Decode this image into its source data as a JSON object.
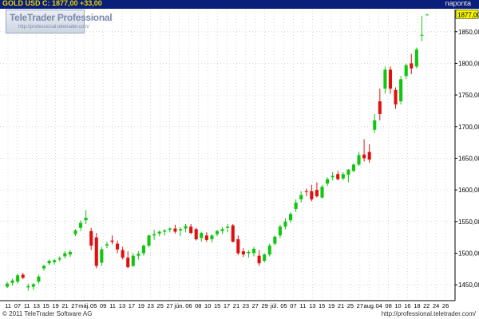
{
  "header": {
    "symbol": "GOLD USD C: 1877,00 +33,00",
    "interval": "naponta"
  },
  "logo": {
    "title": "TeleTrader Professional",
    "subtitle": "http://professional.teletrader.com/"
  },
  "footer": {
    "copyright": "© 2011 TeleTrader Software AG",
    "link": "http://professional.teletrader.com/"
  },
  "colors": {
    "up": "#11c611",
    "down": "#e01010",
    "background": "#ffffff",
    "grid": "#bdbdbd",
    "header_bg": "#0a1f7a",
    "symbol_text": "#e8d400",
    "last_price_box": "#f5f500"
  },
  "chart_data": {
    "type": "candlestick",
    "y_axis_side": "right",
    "ylim": [
      1425,
      1885
    ],
    "ytick_values": [
      1450,
      1500,
      1550,
      1600,
      1650,
      1700,
      1750,
      1800,
      1850
    ],
    "ytick_labels": [
      "1450,00",
      "1500,00",
      "1550,00",
      "1600,00",
      "1650,00",
      "1700,00",
      "1750,00",
      "1800,00",
      "1850,00"
    ],
    "last_price": 1877.0,
    "last_price_label": "1877,00",
    "grid": true,
    "x_labels": [
      "11",
      "07",
      "11",
      "13",
      "15",
      "19",
      "21",
      "27",
      "máj.",
      "05",
      "09",
      "11",
      "13",
      "17",
      "19",
      "23",
      "25",
      "27",
      "jún.",
      "06",
      "08",
      "10",
      "15",
      "17",
      "21",
      "23",
      "27",
      "29",
      "júl.",
      "05",
      "07",
      "11",
      "13",
      "15",
      "19",
      "21",
      "25",
      "27",
      "aug.",
      "04",
      "08",
      "10",
      "16",
      "18",
      "22",
      "24",
      "26"
    ],
    "candles": [
      {
        "o": 1447,
        "h": 1455,
        "l": 1445,
        "c": 1452
      },
      {
        "o": 1453,
        "h": 1460,
        "l": 1449,
        "c": 1457
      },
      {
        "o": 1455,
        "h": 1468,
        "l": 1452,
        "c": 1465
      },
      {
        "o": 1466,
        "h": 1469,
        "l": 1459,
        "c": 1461
      },
      {
        "o": 1446,
        "h": 1452,
        "l": 1441,
        "c": 1448
      },
      {
        "o": 1447,
        "h": 1453,
        "l": 1442,
        "c": 1451
      },
      {
        "o": 1455,
        "h": 1466,
        "l": 1452,
        "c": 1463
      },
      {
        "o": 1476,
        "h": 1482,
        "l": 1472,
        "c": 1480
      },
      {
        "o": 1484,
        "h": 1490,
        "l": 1481,
        "c": 1488
      },
      {
        "o": 1486,
        "h": 1491,
        "l": 1482,
        "c": 1489
      },
      {
        "o": 1490,
        "h": 1495,
        "l": 1487,
        "c": 1492
      },
      {
        "o": 1495,
        "h": 1503,
        "l": 1492,
        "c": 1500
      },
      {
        "o": 1498,
        "h": 1505,
        "l": 1494,
        "c": 1502
      },
      {
        "o": 1530,
        "h": 1538,
        "l": 1527,
        "c": 1536
      },
      {
        "o": 1540,
        "h": 1552,
        "l": 1535,
        "c": 1548
      },
      {
        "o": 1552,
        "h": 1568,
        "l": 1546,
        "c": 1556
      },
      {
        "o": 1535,
        "h": 1540,
        "l": 1505,
        "c": 1512
      },
      {
        "o": 1525,
        "h": 1532,
        "l": 1476,
        "c": 1480
      },
      {
        "o": 1485,
        "h": 1510,
        "l": 1480,
        "c": 1506
      },
      {
        "o": 1512,
        "h": 1518,
        "l": 1508,
        "c": 1514
      },
      {
        "o": 1520,
        "h": 1528,
        "l": 1514,
        "c": 1518
      },
      {
        "o": 1515,
        "h": 1520,
        "l": 1500,
        "c": 1506
      },
      {
        "o": 1505,
        "h": 1510,
        "l": 1490,
        "c": 1493
      },
      {
        "o": 1493,
        "h": 1503,
        "l": 1476,
        "c": 1478
      },
      {
        "o": 1480,
        "h": 1500,
        "l": 1478,
        "c": 1496
      },
      {
        "o": 1496,
        "h": 1503,
        "l": 1490,
        "c": 1499
      },
      {
        "o": 1500,
        "h": 1514,
        "l": 1496,
        "c": 1512
      },
      {
        "o": 1512,
        "h": 1530,
        "l": 1509,
        "c": 1528
      },
      {
        "o": 1528,
        "h": 1537,
        "l": 1521,
        "c": 1530
      },
      {
        "o": 1531,
        "h": 1536,
        "l": 1527,
        "c": 1534
      },
      {
        "o": 1534,
        "h": 1538,
        "l": 1528,
        "c": 1536
      },
      {
        "o": 1537,
        "h": 1541,
        "l": 1533,
        "c": 1539
      },
      {
        "o": 1539,
        "h": 1545,
        "l": 1531,
        "c": 1534
      },
      {
        "o": 1536,
        "h": 1541,
        "l": 1527,
        "c": 1538
      },
      {
        "o": 1539,
        "h": 1546,
        "l": 1533,
        "c": 1543
      },
      {
        "o": 1542,
        "h": 1546,
        "l": 1530,
        "c": 1532
      },
      {
        "o": 1538,
        "h": 1540,
        "l": 1520,
        "c": 1522
      },
      {
        "o": 1524,
        "h": 1534,
        "l": 1518,
        "c": 1532
      },
      {
        "o": 1528,
        "h": 1533,
        "l": 1518,
        "c": 1521
      },
      {
        "o": 1522,
        "h": 1530,
        "l": 1517,
        "c": 1528
      },
      {
        "o": 1530,
        "h": 1537,
        "l": 1527,
        "c": 1535
      },
      {
        "o": 1535,
        "h": 1541,
        "l": 1530,
        "c": 1538
      },
      {
        "o": 1540,
        "h": 1546,
        "l": 1533,
        "c": 1542
      },
      {
        "o": 1544,
        "h": 1546,
        "l": 1517,
        "c": 1518
      },
      {
        "o": 1522,
        "h": 1528,
        "l": 1497,
        "c": 1500
      },
      {
        "o": 1503,
        "h": 1508,
        "l": 1494,
        "c": 1498
      },
      {
        "o": 1500,
        "h": 1505,
        "l": 1493,
        "c": 1502
      },
      {
        "o": 1500,
        "h": 1510,
        "l": 1495,
        "c": 1507
      },
      {
        "o": 1496,
        "h": 1505,
        "l": 1480,
        "c": 1484
      },
      {
        "o": 1488,
        "h": 1500,
        "l": 1485,
        "c": 1498
      },
      {
        "o": 1498,
        "h": 1515,
        "l": 1495,
        "c": 1512
      },
      {
        "o": 1515,
        "h": 1528,
        "l": 1512,
        "c": 1526
      },
      {
        "o": 1528,
        "h": 1545,
        "l": 1524,
        "c": 1542
      },
      {
        "o": 1542,
        "h": 1555,
        "l": 1538,
        "c": 1550
      },
      {
        "o": 1552,
        "h": 1565,
        "l": 1548,
        "c": 1562
      },
      {
        "o": 1570,
        "h": 1585,
        "l": 1565,
        "c": 1580
      },
      {
        "o": 1585,
        "h": 1598,
        "l": 1580,
        "c": 1592
      },
      {
        "o": 1598,
        "h": 1602,
        "l": 1590,
        "c": 1597
      },
      {
        "o": 1598,
        "h": 1608,
        "l": 1582,
        "c": 1585
      },
      {
        "o": 1600,
        "h": 1612,
        "l": 1588,
        "c": 1590
      },
      {
        "o": 1588,
        "h": 1608,
        "l": 1586,
        "c": 1605
      },
      {
        "o": 1610,
        "h": 1620,
        "l": 1606,
        "c": 1617
      },
      {
        "o": 1620,
        "h": 1628,
        "l": 1615,
        "c": 1622
      },
      {
        "o": 1625,
        "h": 1630,
        "l": 1615,
        "c": 1617
      },
      {
        "o": 1618,
        "h": 1628,
        "l": 1615,
        "c": 1625
      },
      {
        "o": 1624,
        "h": 1633,
        "l": 1612,
        "c": 1632
      },
      {
        "o": 1630,
        "h": 1642,
        "l": 1628,
        "c": 1640
      },
      {
        "o": 1640,
        "h": 1660,
        "l": 1638,
        "c": 1655
      },
      {
        "o": 1656,
        "h": 1680,
        "l": 1645,
        "c": 1650
      },
      {
        "o": 1660,
        "h": 1672,
        "l": 1643,
        "c": 1648
      },
      {
        "o": 1695,
        "h": 1720,
        "l": 1690,
        "c": 1710
      },
      {
        "o": 1740,
        "h": 1760,
        "l": 1710,
        "c": 1720
      },
      {
        "o": 1760,
        "h": 1795,
        "l": 1752,
        "c": 1790
      },
      {
        "o": 1790,
        "h": 1795,
        "l": 1752,
        "c": 1760
      },
      {
        "o": 1758,
        "h": 1762,
        "l": 1728,
        "c": 1735
      },
      {
        "o": 1740,
        "h": 1780,
        "l": 1735,
        "c": 1775
      },
      {
        "o": 1780,
        "h": 1800,
        "l": 1775,
        "c": 1797
      },
      {
        "o": 1800,
        "h": 1815,
        "l": 1783,
        "c": 1792
      },
      {
        "o": 1795,
        "h": 1825,
        "l": 1792,
        "c": 1822
      },
      {
        "o": 1845,
        "h": 1875,
        "l": 1835,
        "c": 1845
      },
      {
        "o": 1877,
        "h": 1878,
        "l": 1876,
        "c": 1877
      }
    ]
  }
}
